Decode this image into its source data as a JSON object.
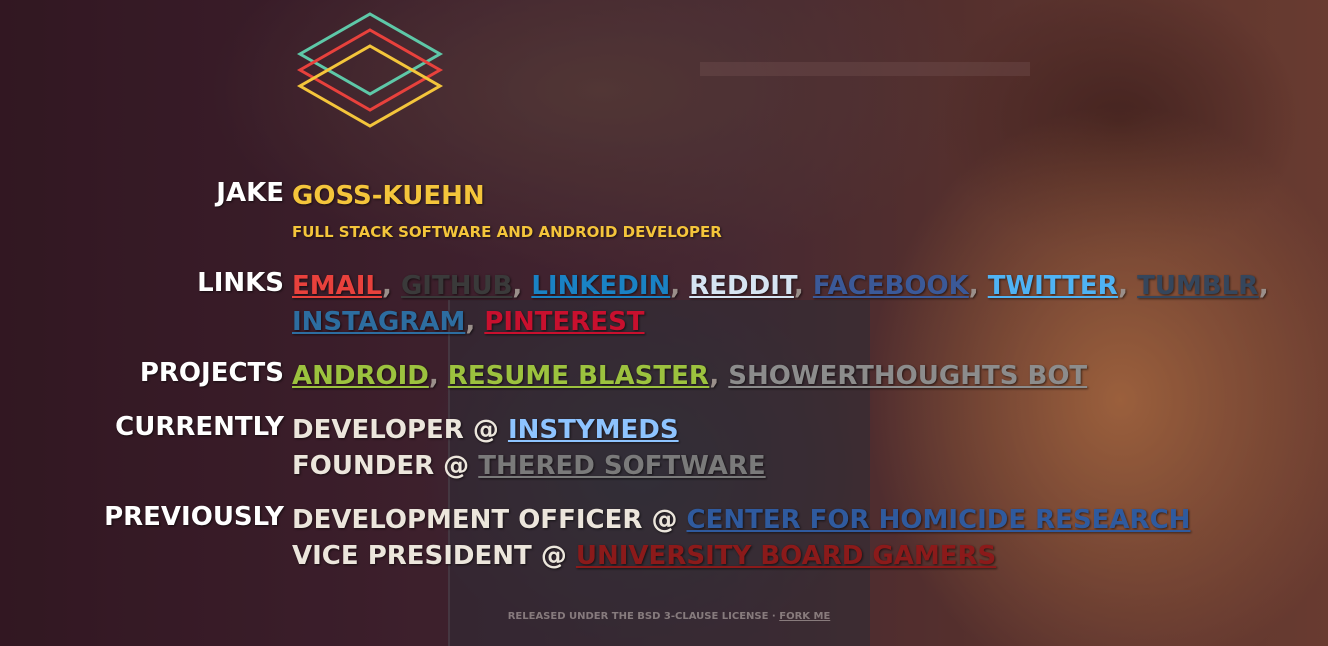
{
  "colors": {
    "logo_teal": "#5ec8a8",
    "logo_red": "#e8413c",
    "logo_yellow": "#f4c53b",
    "accent_yellow": "#f4c53b"
  },
  "header": {
    "first_name": "JAKE",
    "last_name": "GOSS-KUEHN",
    "tagline": "FULL STACK SOFTWARE AND ANDROID DEVELOPER"
  },
  "links": {
    "label": "LINKS",
    "items": [
      {
        "text": "EMAIL",
        "color": "#e8413c"
      },
      {
        "text": "GITHUB",
        "color": "#3a3a3a"
      },
      {
        "text": "LINKEDIN",
        "color": "#1a82c4"
      },
      {
        "text": "REDDIT",
        "color": "#d6e4f2"
      },
      {
        "text": "FACEBOOK",
        "color": "#3b5998"
      },
      {
        "text": "TWITTER",
        "color": "#4fb3f4"
      },
      {
        "text": "TUMBLR",
        "color": "#35465c"
      },
      {
        "text": "INSTAGRAM",
        "color": "#2d6da0"
      },
      {
        "text": "PINTEREST",
        "color": "#c8102e"
      }
    ]
  },
  "projects": {
    "label": "PROJECTS",
    "items": [
      {
        "text": "ANDROID",
        "color": "#9cc23e"
      },
      {
        "text": "RESUME BLASTER",
        "color": "#9cc23e"
      },
      {
        "text": "SHOWERTHOUGHTS BOT",
        "color": "#8c8c8c"
      }
    ]
  },
  "currently": {
    "label": "CURRENTLY",
    "roles": [
      {
        "title": "DEVELOPER",
        "at": "@",
        "org": "INSTYMEDS",
        "org_color": "#8ec4ff"
      },
      {
        "title": "FOUNDER",
        "at": "@",
        "org": "THERED SOFTWARE",
        "org_color": "#7a7a7a"
      }
    ]
  },
  "previously": {
    "label": "PREVIOUSLY",
    "roles": [
      {
        "title": "DEVELOPMENT OFFICER",
        "at": "@",
        "org": "CENTER FOR HOMICIDE RESEARCH",
        "org_color": "#2f5a9e"
      },
      {
        "title": "VICE PRESIDENT",
        "at": "@",
        "org": "UNIVERSITY BOARD GAMERS",
        "org_color": "#8b1a1a"
      }
    ]
  },
  "footer": {
    "text": "RELEASED UNDER THE BSD 3-CLAUSE LICENSE ·",
    "link": "FORK ME"
  }
}
